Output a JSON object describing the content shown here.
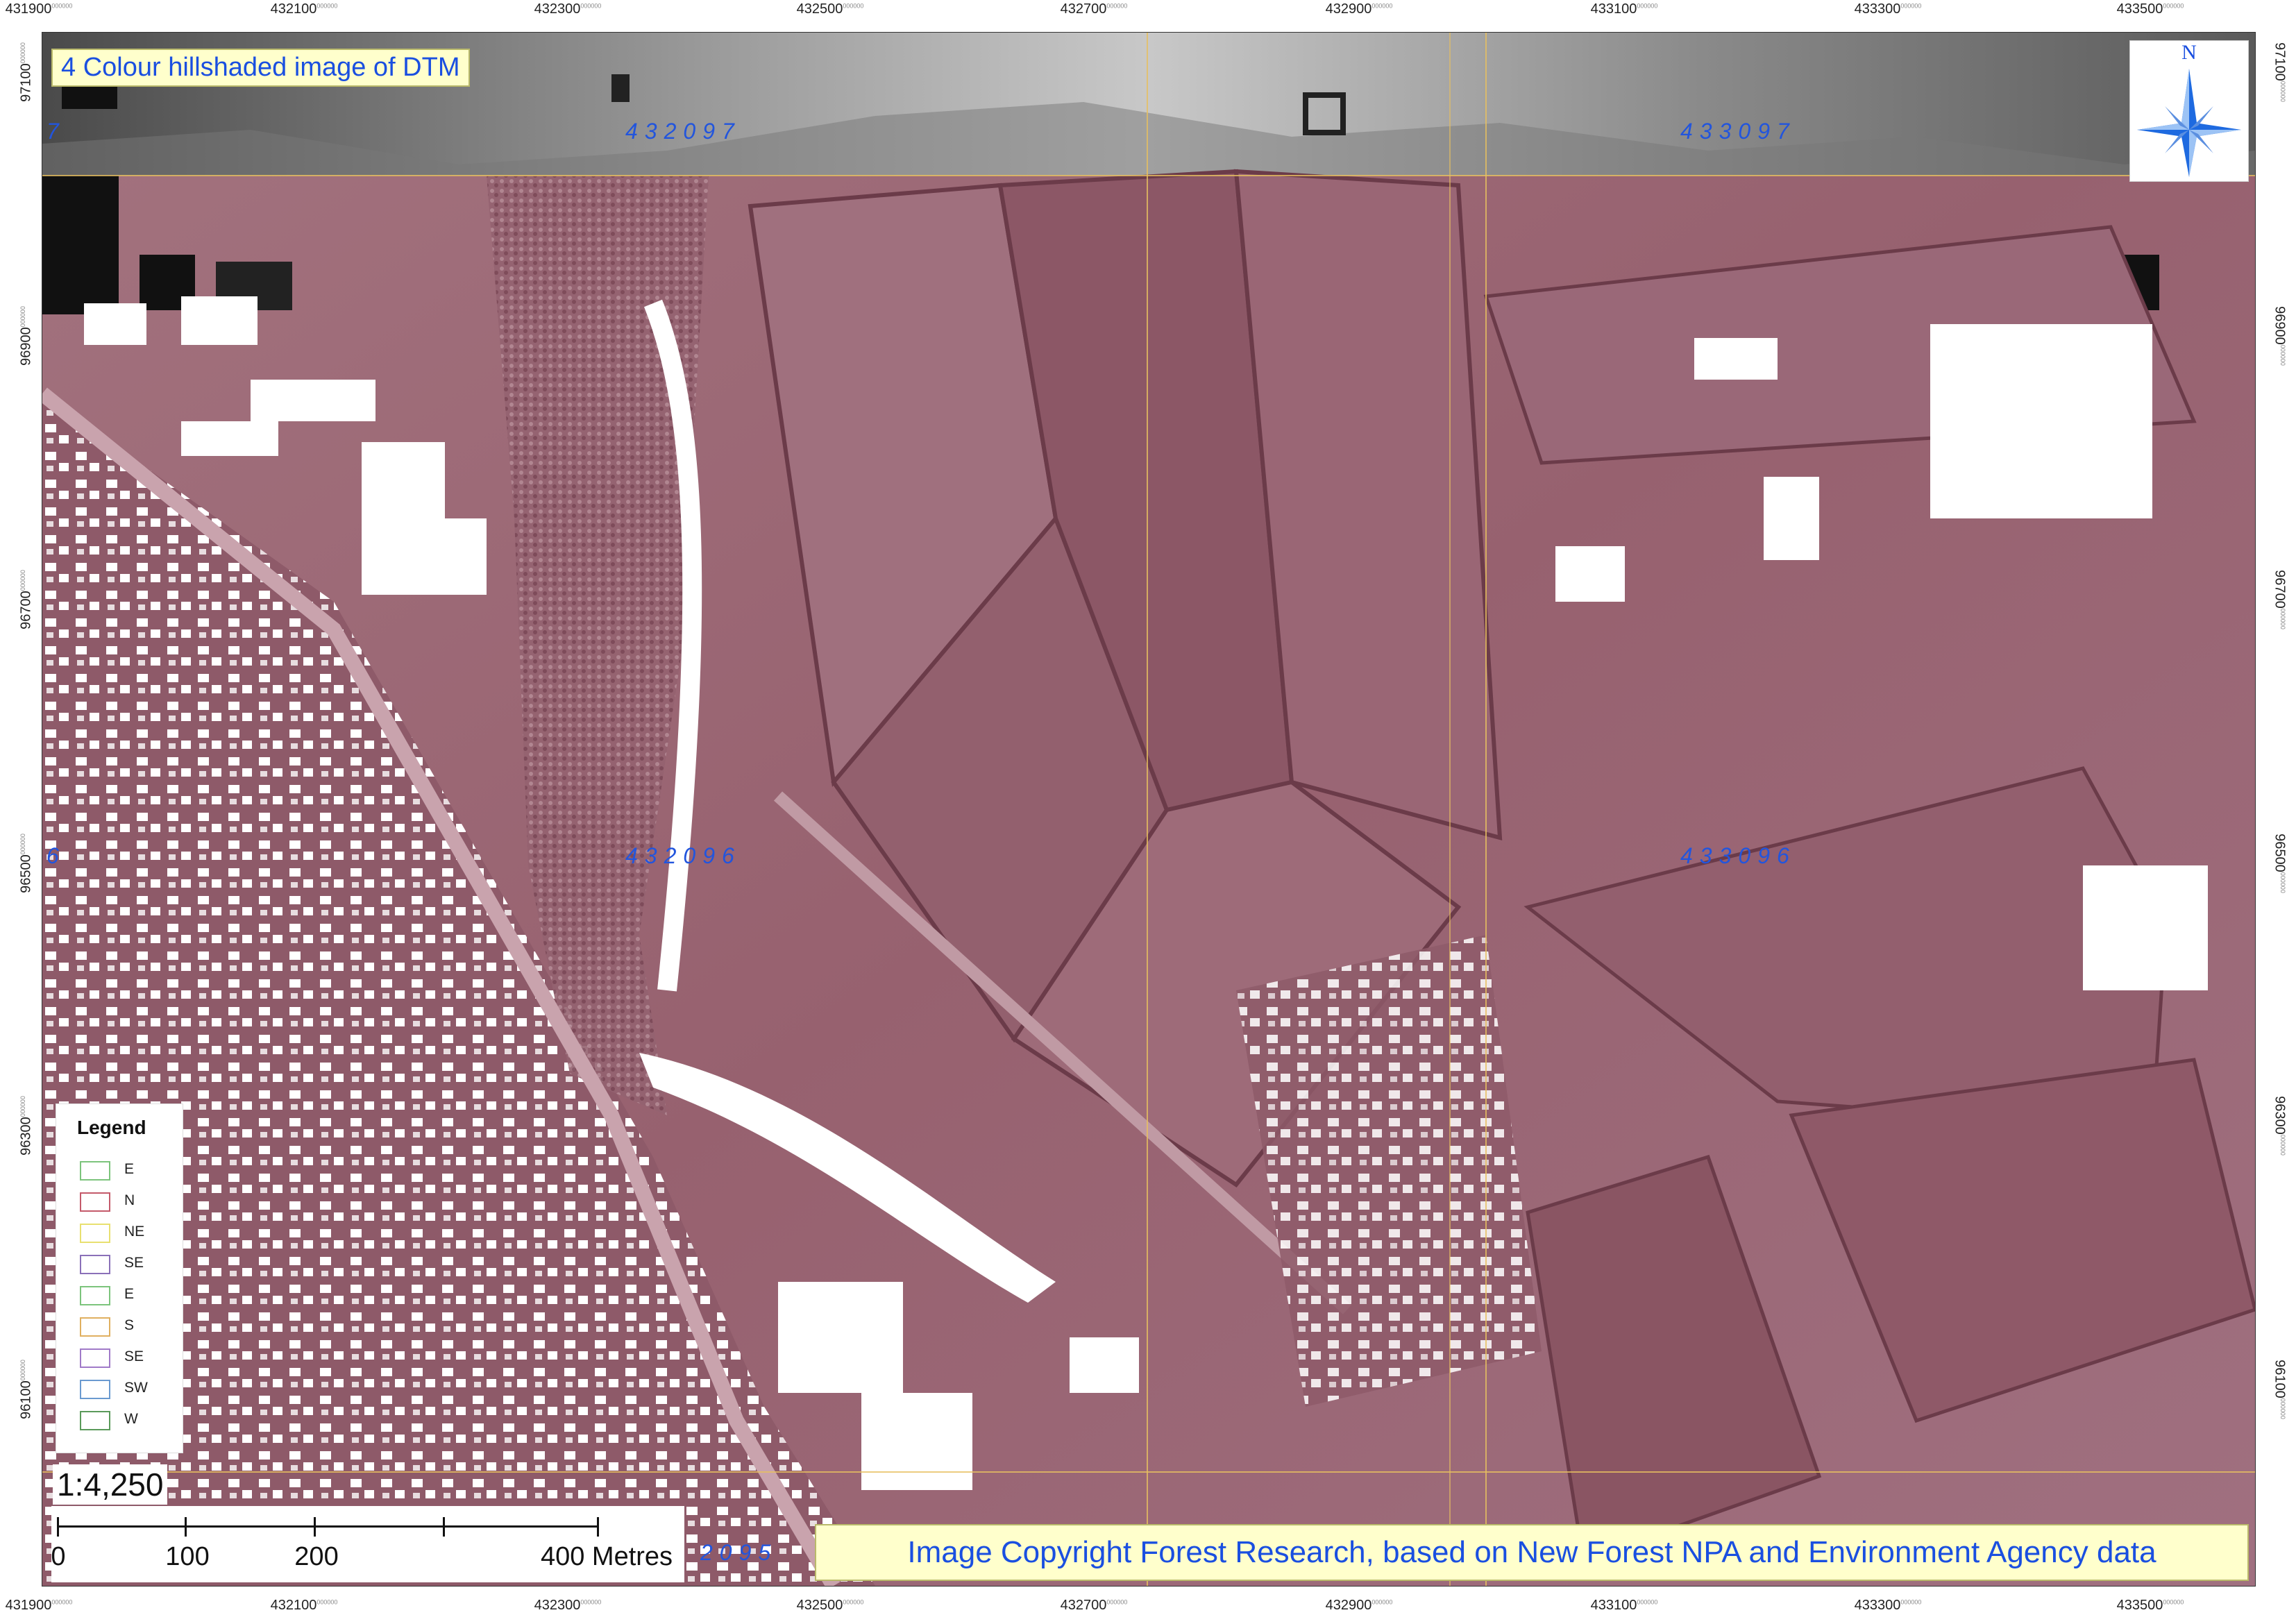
{
  "map": {
    "title": "4 Colour hillshaded image of DTM",
    "north_label": "N",
    "scale_ratio": "1:4,250",
    "copyright": "Image Copyright Forest Research, based on New Forest NPA and Environment Agency data",
    "colors": {
      "relief_base": "#9a6573",
      "relief_dark": "#6e3d4b",
      "grey_strip": "#8c8c8c",
      "label_blue": "#1a4fe0",
      "label_box_bg": "#ffffcc"
    },
    "x_ticks": [
      {
        "value": "431900",
        "suffix": "000000"
      },
      {
        "value": "432100",
        "suffix": "000000"
      },
      {
        "value": "432300",
        "suffix": "000000"
      },
      {
        "value": "432500",
        "suffix": "000000"
      },
      {
        "value": "432700",
        "suffix": "000000"
      },
      {
        "value": "432900",
        "suffix": "000000"
      },
      {
        "value": "433100",
        "suffix": "000000"
      },
      {
        "value": "433300",
        "suffix": "000000"
      },
      {
        "value": "433500",
        "suffix": "000000"
      }
    ],
    "y_ticks": [
      {
        "value": "97100",
        "suffix": "000000"
      },
      {
        "value": "96900",
        "suffix": "000000"
      },
      {
        "value": "96700",
        "suffix": "000000"
      },
      {
        "value": "96500",
        "suffix": "000000"
      },
      {
        "value": "96300",
        "suffix": "000000"
      },
      {
        "value": "96100",
        "suffix": "000000"
      }
    ],
    "grid_labels": {
      "nw": "432097",
      "ne": "433097",
      "sw": "432096",
      "se": "433096",
      "left_top": "7",
      "left_mid": "6",
      "bottom": "2095"
    },
    "legend": {
      "title": "Legend",
      "items": [
        {
          "label": "E",
          "color": "#7cc47c"
        },
        {
          "label": "N",
          "color": "#c45a6a"
        },
        {
          "label": "NE",
          "color": "#e8e070"
        },
        {
          "label": "SE",
          "color": "#8a70b8"
        },
        {
          "label": "E",
          "color": "#7cc47c"
        },
        {
          "label": "S",
          "color": "#e0b060"
        },
        {
          "label": "SE",
          "color": "#a07ac8"
        },
        {
          "label": "SW",
          "color": "#6a9ad0"
        },
        {
          "label": "W",
          "color": "#5a9a5a"
        }
      ]
    },
    "scalebar": {
      "labels": [
        "0",
        "100",
        "200",
        "400 Metres"
      ]
    }
  }
}
